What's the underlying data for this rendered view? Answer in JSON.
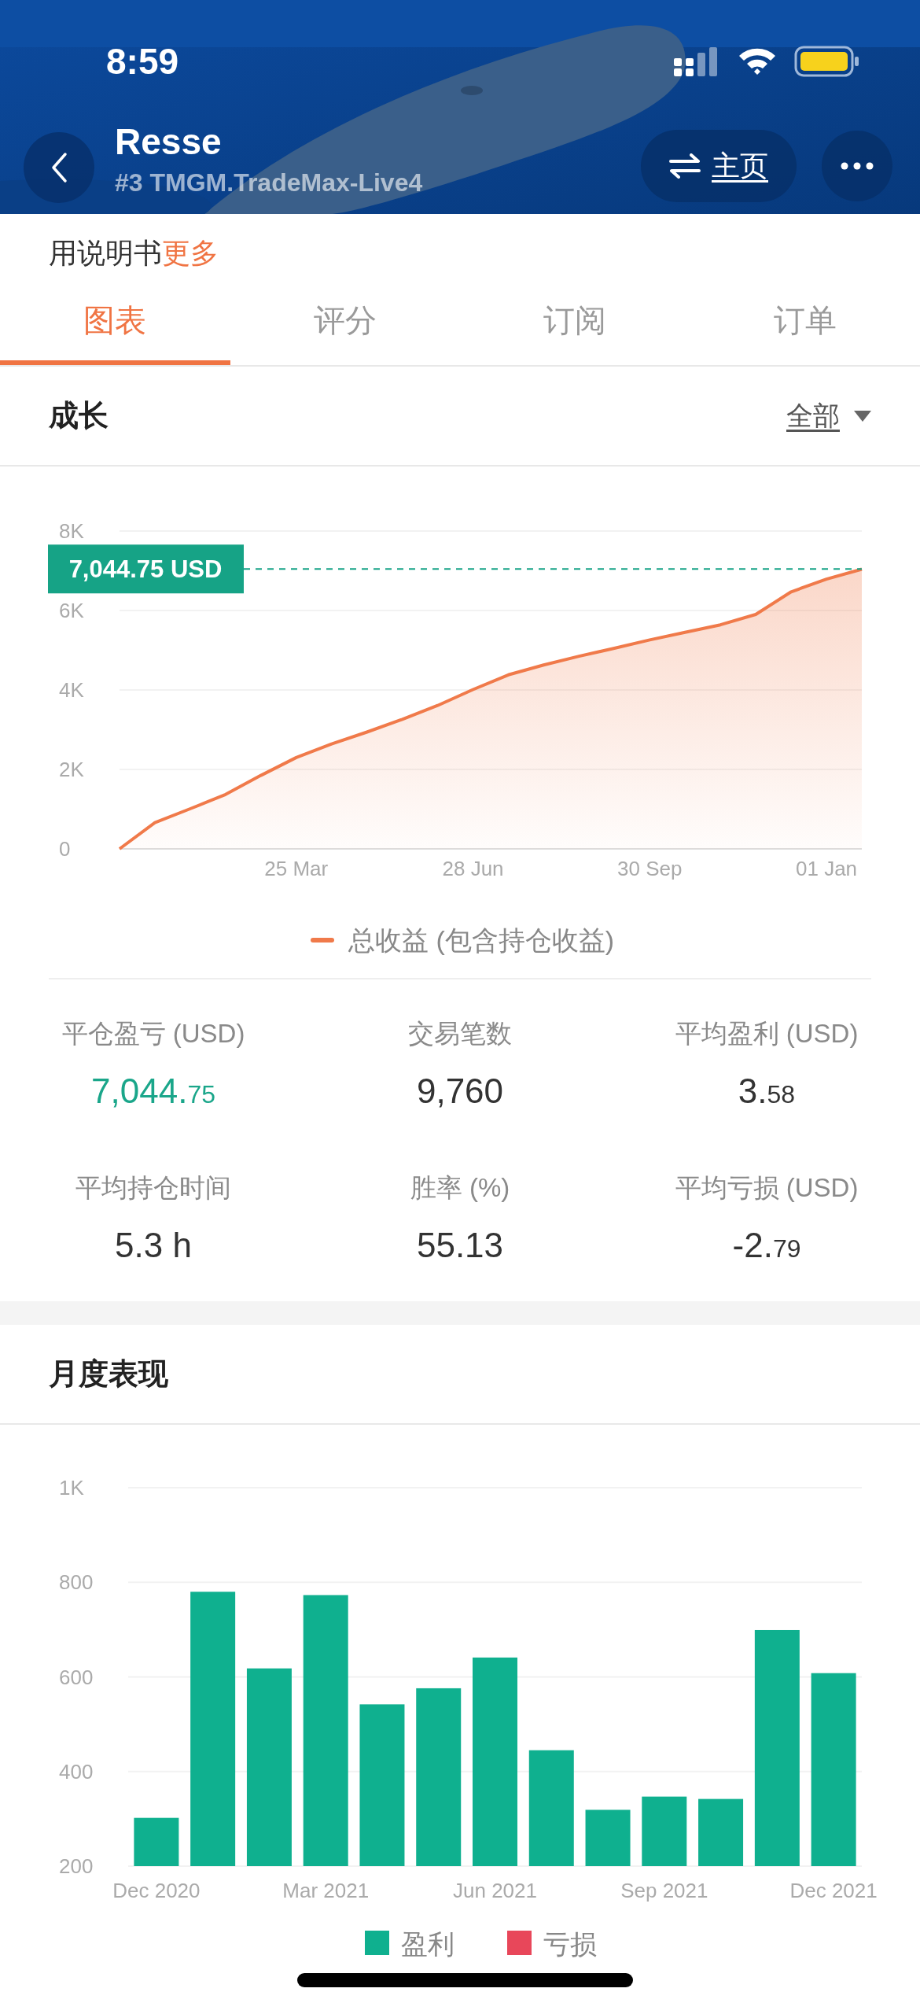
{
  "status_bar": {
    "time": "8:59"
  },
  "header": {
    "title": "Resse",
    "subtitle": "#3 TMGM.TradeMax-Live4",
    "home_button": "主页"
  },
  "description": {
    "text": "用说明书",
    "more_link": "更多"
  },
  "tabs": [
    {
      "label": "图表",
      "selected": true
    },
    {
      "label": "评分",
      "selected": false
    },
    {
      "label": "订阅",
      "selected": false
    },
    {
      "label": "订单",
      "selected": false
    }
  ],
  "growth": {
    "title": "成长",
    "filter": "全部",
    "chart_data": {
      "type": "area",
      "grid": true,
      "ref_lines": [
        {
          "axis": "y",
          "value": 7044.75,
          "label": "7,044.75 USD",
          "color": "#16a386"
        }
      ],
      "categories": [
        null,
        null,
        null,
        null,
        null,
        "25 Mar",
        null,
        null,
        null,
        null,
        "28 Jun",
        null,
        null,
        null,
        null,
        "30 Sep",
        null,
        null,
        null,
        null,
        "01 Jan",
        null
      ],
      "series": [
        {
          "name": "总收益 (包含持仓收益)",
          "color": "#f07a4a",
          "values": [
            0,
            660,
            1010,
            1370,
            1850,
            2300,
            2640,
            2940,
            3260,
            3610,
            4010,
            4380,
            4630,
            4850,
            5050,
            5260,
            5450,
            5640,
            5900,
            6470,
            6790,
            7040
          ]
        }
      ],
      "ylim": [
        0,
        8000
      ],
      "yticks": [
        {
          "value": 0,
          "label": "0"
        },
        {
          "value": 2000,
          "label": "2K"
        },
        {
          "value": 4000,
          "label": "4K"
        },
        {
          "value": 6000,
          "label": "6K"
        },
        {
          "value": 8000,
          "label": "8K"
        }
      ]
    }
  },
  "stats": [
    {
      "label": "平仓盈亏 (USD)",
      "value": "7,044.",
      "value_small": "75",
      "color": "#1aa68a"
    },
    {
      "label": "交易笔数",
      "value": "9,760",
      "color": "#333333"
    },
    {
      "label": "平均盈利 (USD)",
      "value": "3.",
      "value_small": "58",
      "color": "#333333"
    },
    {
      "label": "平均持仓时间",
      "value": "5.3 h",
      "color": "#333333"
    },
    {
      "label": "胜率 (%)",
      "value": "55.13",
      "color": "#333333"
    },
    {
      "label": "平均亏损 (USD)",
      "value": "-2.",
      "value_small": "79",
      "color": "#333333"
    }
  ],
  "monthly": {
    "title": "月度表现",
    "chart_data": {
      "type": "bar",
      "categories": [
        "Dec 2020",
        null,
        null,
        "Mar 2021",
        null,
        null,
        "Jun 2021",
        null,
        null,
        "Sep 2021",
        null,
        null,
        "Dec 2021"
      ],
      "series": [
        {
          "name": "盈利",
          "color": "#0fb08f",
          "values": [
            302,
            780,
            618,
            773,
            542,
            576,
            641,
            445,
            319,
            347,
            342,
            699,
            608
          ]
        },
        {
          "name": "亏损",
          "color": "#e8475a",
          "values": [
            null,
            null,
            null,
            null,
            null,
            null,
            null,
            null,
            null,
            null,
            null,
            null,
            null
          ]
        }
      ],
      "ylim": [
        200,
        1000
      ],
      "grid": true,
      "yticks": [
        {
          "value": 200,
          "label": "200"
        },
        {
          "value": 400,
          "label": "400"
        },
        {
          "value": 600,
          "label": "600"
        },
        {
          "value": 800,
          "label": "800"
        },
        {
          "value": 1000,
          "label": "1K"
        }
      ]
    }
  }
}
